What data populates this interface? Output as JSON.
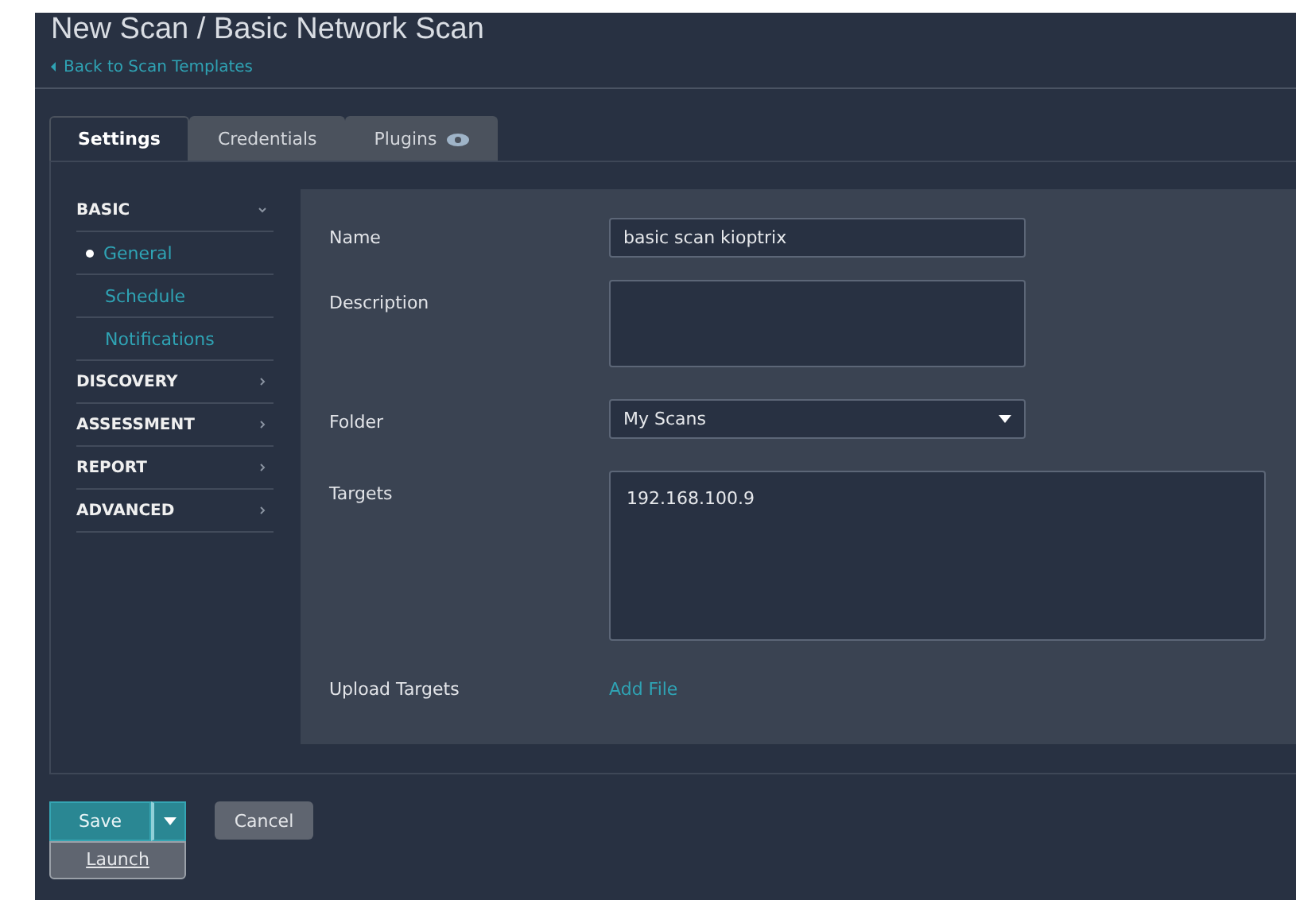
{
  "header": {
    "title": "New Scan / Basic Network Scan",
    "back_link": "Back to Scan Templates"
  },
  "tabs": [
    {
      "label": "Settings",
      "selected": true,
      "icon": false
    },
    {
      "label": "Credentials",
      "selected": false,
      "icon": false
    },
    {
      "label": "Plugins",
      "selected": false,
      "icon": true
    }
  ],
  "sidebar": [
    {
      "label": "BASIC",
      "expanded": true,
      "children": [
        {
          "label": "General",
          "selected": true
        },
        {
          "label": "Schedule",
          "selected": false
        },
        {
          "label": "Notifications",
          "selected": false
        }
      ]
    },
    {
      "label": "DISCOVERY",
      "expanded": false
    },
    {
      "label": "ASSESSMENT",
      "expanded": false
    },
    {
      "label": "REPORT",
      "expanded": false
    },
    {
      "label": "ADVANCED",
      "expanded": false
    }
  ],
  "form": [
    {
      "kind": "input",
      "label": "Name",
      "value": "basic scan kioptrix"
    },
    {
      "kind": "textarea",
      "label": "Description"
    },
    {
      "kind": "select",
      "label": "Folder",
      "value": "My Scans"
    },
    {
      "kind": "targets",
      "label": "Targets",
      "value": "192.168.100.9"
    },
    {
      "kind": "link",
      "label": "Upload Targets",
      "value": "Add File"
    }
  ],
  "actions": {
    "save": "Save",
    "cancel": "Cancel",
    "menu_open": true,
    "menu": [
      "Launch"
    ]
  }
}
